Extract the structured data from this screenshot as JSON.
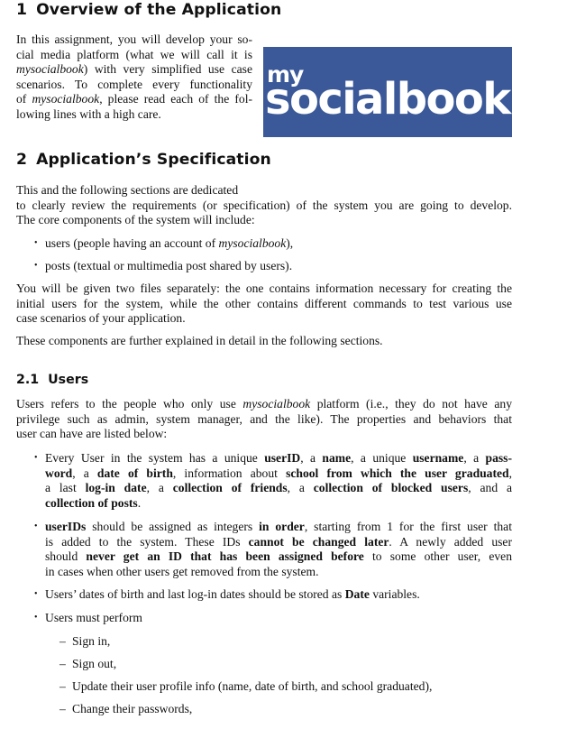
{
  "section1": {
    "number": "1",
    "title": "Overview of the Application",
    "lines": [
      "In this assignment, you will develop your so-",
      "cial media platform (what we will call it is",
      ") with very simplified use case",
      "scenarios.  To complete every functionality",
      ", please read each of the fol-",
      "lowing lines with a high care."
    ],
    "app_name_italic": "mysocialbook",
    "of_prefix": "of ",
    "logo": {
      "my": "my",
      "socialbook": "socialbook",
      "background_color": "#3b5998",
      "text_color": "#ffffff"
    }
  },
  "section2": {
    "number": "2",
    "title": "Application’s Specification",
    "intro_lines": [
      "This and the following sections are dedicated",
      "to clearly review the requirements (or specification) of the system you are going to develop.",
      "The core components of the system will include:"
    ],
    "components": [
      {
        "prefix": "users (people having an account of ",
        "italic": "mysocialbook",
        "suffix": "),"
      },
      {
        "prefix": "posts (textual or multimedia post shared by users).",
        "italic": "",
        "suffix": ""
      }
    ],
    "files_para": [
      "You will be given two files separately: the one contains information necessary for creating the",
      "initial users for the system, while the other contains different commands to test various use",
      "case scenarios of your application."
    ],
    "further_para": "These components are further explained in detail in the following sections."
  },
  "section21": {
    "number": "2.1",
    "title": "Users",
    "intro": {
      "l1_prefix": "Users refers to the people who only use ",
      "l1_italic": "mysocialbook",
      "l1_suffix": " platform (i.e., they do not have any",
      "l2": "privilege such as admin, system manager, and the like).  The properties and behaviors that",
      "l3": "user can have are listed below:"
    },
    "bullet1": [
      {
        "t": "Every User in the system has a unique "
      },
      {
        "b": "userID"
      },
      {
        "t": ", a "
      },
      {
        "b": "name"
      },
      {
        "t": ", a unique "
      },
      {
        "b": "username"
      },
      {
        "t": ", a "
      },
      {
        "b": "pass-word"
      },
      {
        "t": ", a "
      },
      {
        "b": "date of birth"
      },
      {
        "t": ", information about "
      },
      {
        "b": "school from which the user graduated"
      },
      {
        "t": ", a last "
      },
      {
        "b": "log-in date"
      },
      {
        "t": ", a "
      },
      {
        "b": "collection of friends"
      },
      {
        "t": ", a "
      },
      {
        "b": "collection of blocked users"
      },
      {
        "t": ", and a "
      },
      {
        "b": "collection of posts"
      },
      {
        "t": "."
      }
    ],
    "bullet1_text": {
      "l1a": "Every User in the system has a unique ",
      "l1b": "userID",
      "l1c": ", a ",
      "l1d": "name",
      "l1e": ", a unique ",
      "l1f": "username",
      "l1g": ", a ",
      "l1h": "pass-",
      "l2a": "word",
      "l2b": ", a ",
      "l2c": "date of birth",
      "l2d": ", information about ",
      "l2e": "school from which the user graduated",
      "l2f": ",",
      "l3a": "a last ",
      "l3b": "log-in date",
      "l3c": ", a ",
      "l3d": "collection of friends",
      "l3e": ", a ",
      "l3f": "collection of blocked users",
      "l3g": ", and a",
      "l4a": "collection of posts",
      "l4b": "."
    },
    "bullet2_text": {
      "l1a": "userIDs",
      "l1b": " should be assigned as integers ",
      "l1c": "in order",
      "l1d": ", starting from 1 for the first user that",
      "l2a": "is added to the system.  These IDs ",
      "l2b": "cannot be changed later",
      "l2c": ".  A newly added user",
      "l3a": "should ",
      "l3b": "never get an ID that has been assigned before",
      "l3c": " to some other user, even",
      "l4": "in cases when other users get removed from the system."
    },
    "bullet3_text": {
      "a": "Users’ dates of birth and last log-in dates should be stored as ",
      "b": "Date",
      "c": " variables."
    },
    "bullet4_text": "Users must perform",
    "actions": [
      "Sign in,",
      "Sign out,",
      "Update their user profile info (name, date of birth, and school graduated),",
      "Change their passwords,"
    ]
  },
  "glyphs": {
    "bullet": "•",
    "dash": "–"
  }
}
